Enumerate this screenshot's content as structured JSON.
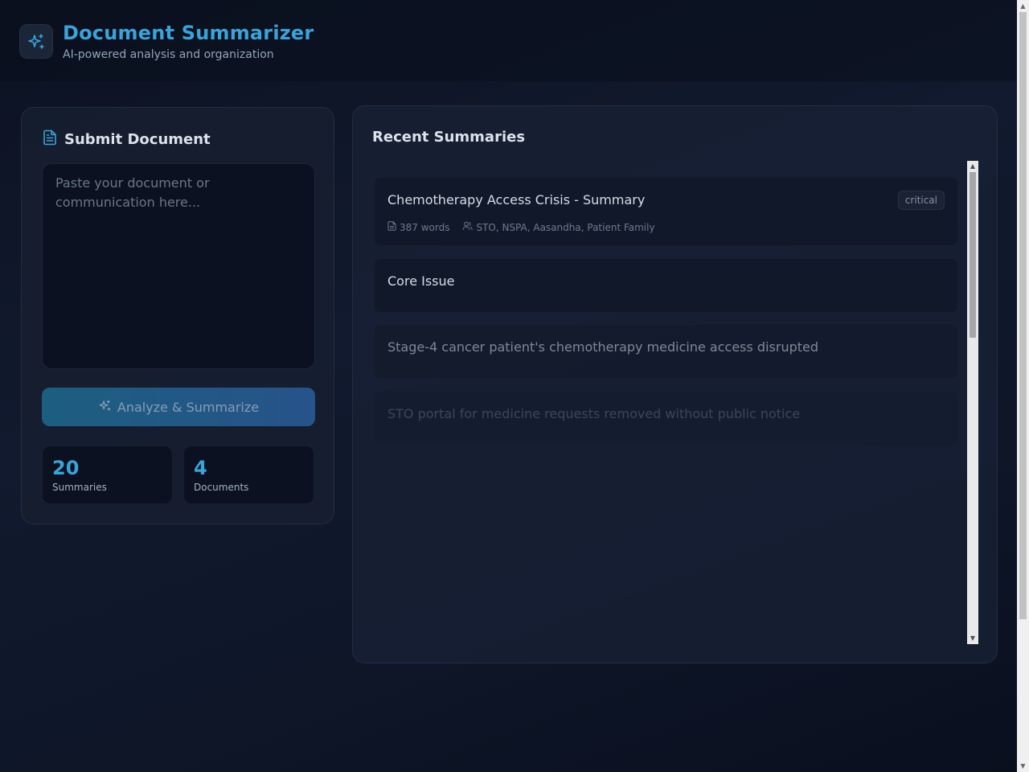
{
  "header": {
    "title": "Document Summarizer",
    "subtitle": "AI-powered analysis and organization",
    "logo_icon": "sparkles-icon"
  },
  "submit_panel": {
    "heading": "Submit Document",
    "heading_icon": "document-icon",
    "input": {
      "value": "",
      "placeholder": "Paste your document or communication here..."
    },
    "analyze_button": {
      "label": "Analyze & Summarize",
      "icon": "sparkles-icon"
    },
    "stats": [
      {
        "value": "20",
        "label": "Summaries"
      },
      {
        "value": "4",
        "label": "Documents"
      }
    ]
  },
  "recent_panel": {
    "heading": "Recent Summaries",
    "summary_card": {
      "title": "Chemotherapy Access Crisis - Summary",
      "badge": "critical",
      "word_count": "387 words",
      "participants": "STO, NSPA, Aasandha, Patient Family"
    },
    "items": [
      {
        "text": "Core Issue",
        "opacity": 1
      },
      {
        "text": "Stage-4 cancer patient's chemotherapy medicine access disrupted",
        "opacity": 0.55
      },
      {
        "text": "STO portal for medicine requests removed without public notice",
        "opacity": 0.2
      }
    ]
  },
  "colors": {
    "accent": "#3ba3d9",
    "background": "#0c1222",
    "panel": "#161e30",
    "button_start": "#1e6a8f",
    "button_end": "#2a5d9a"
  }
}
